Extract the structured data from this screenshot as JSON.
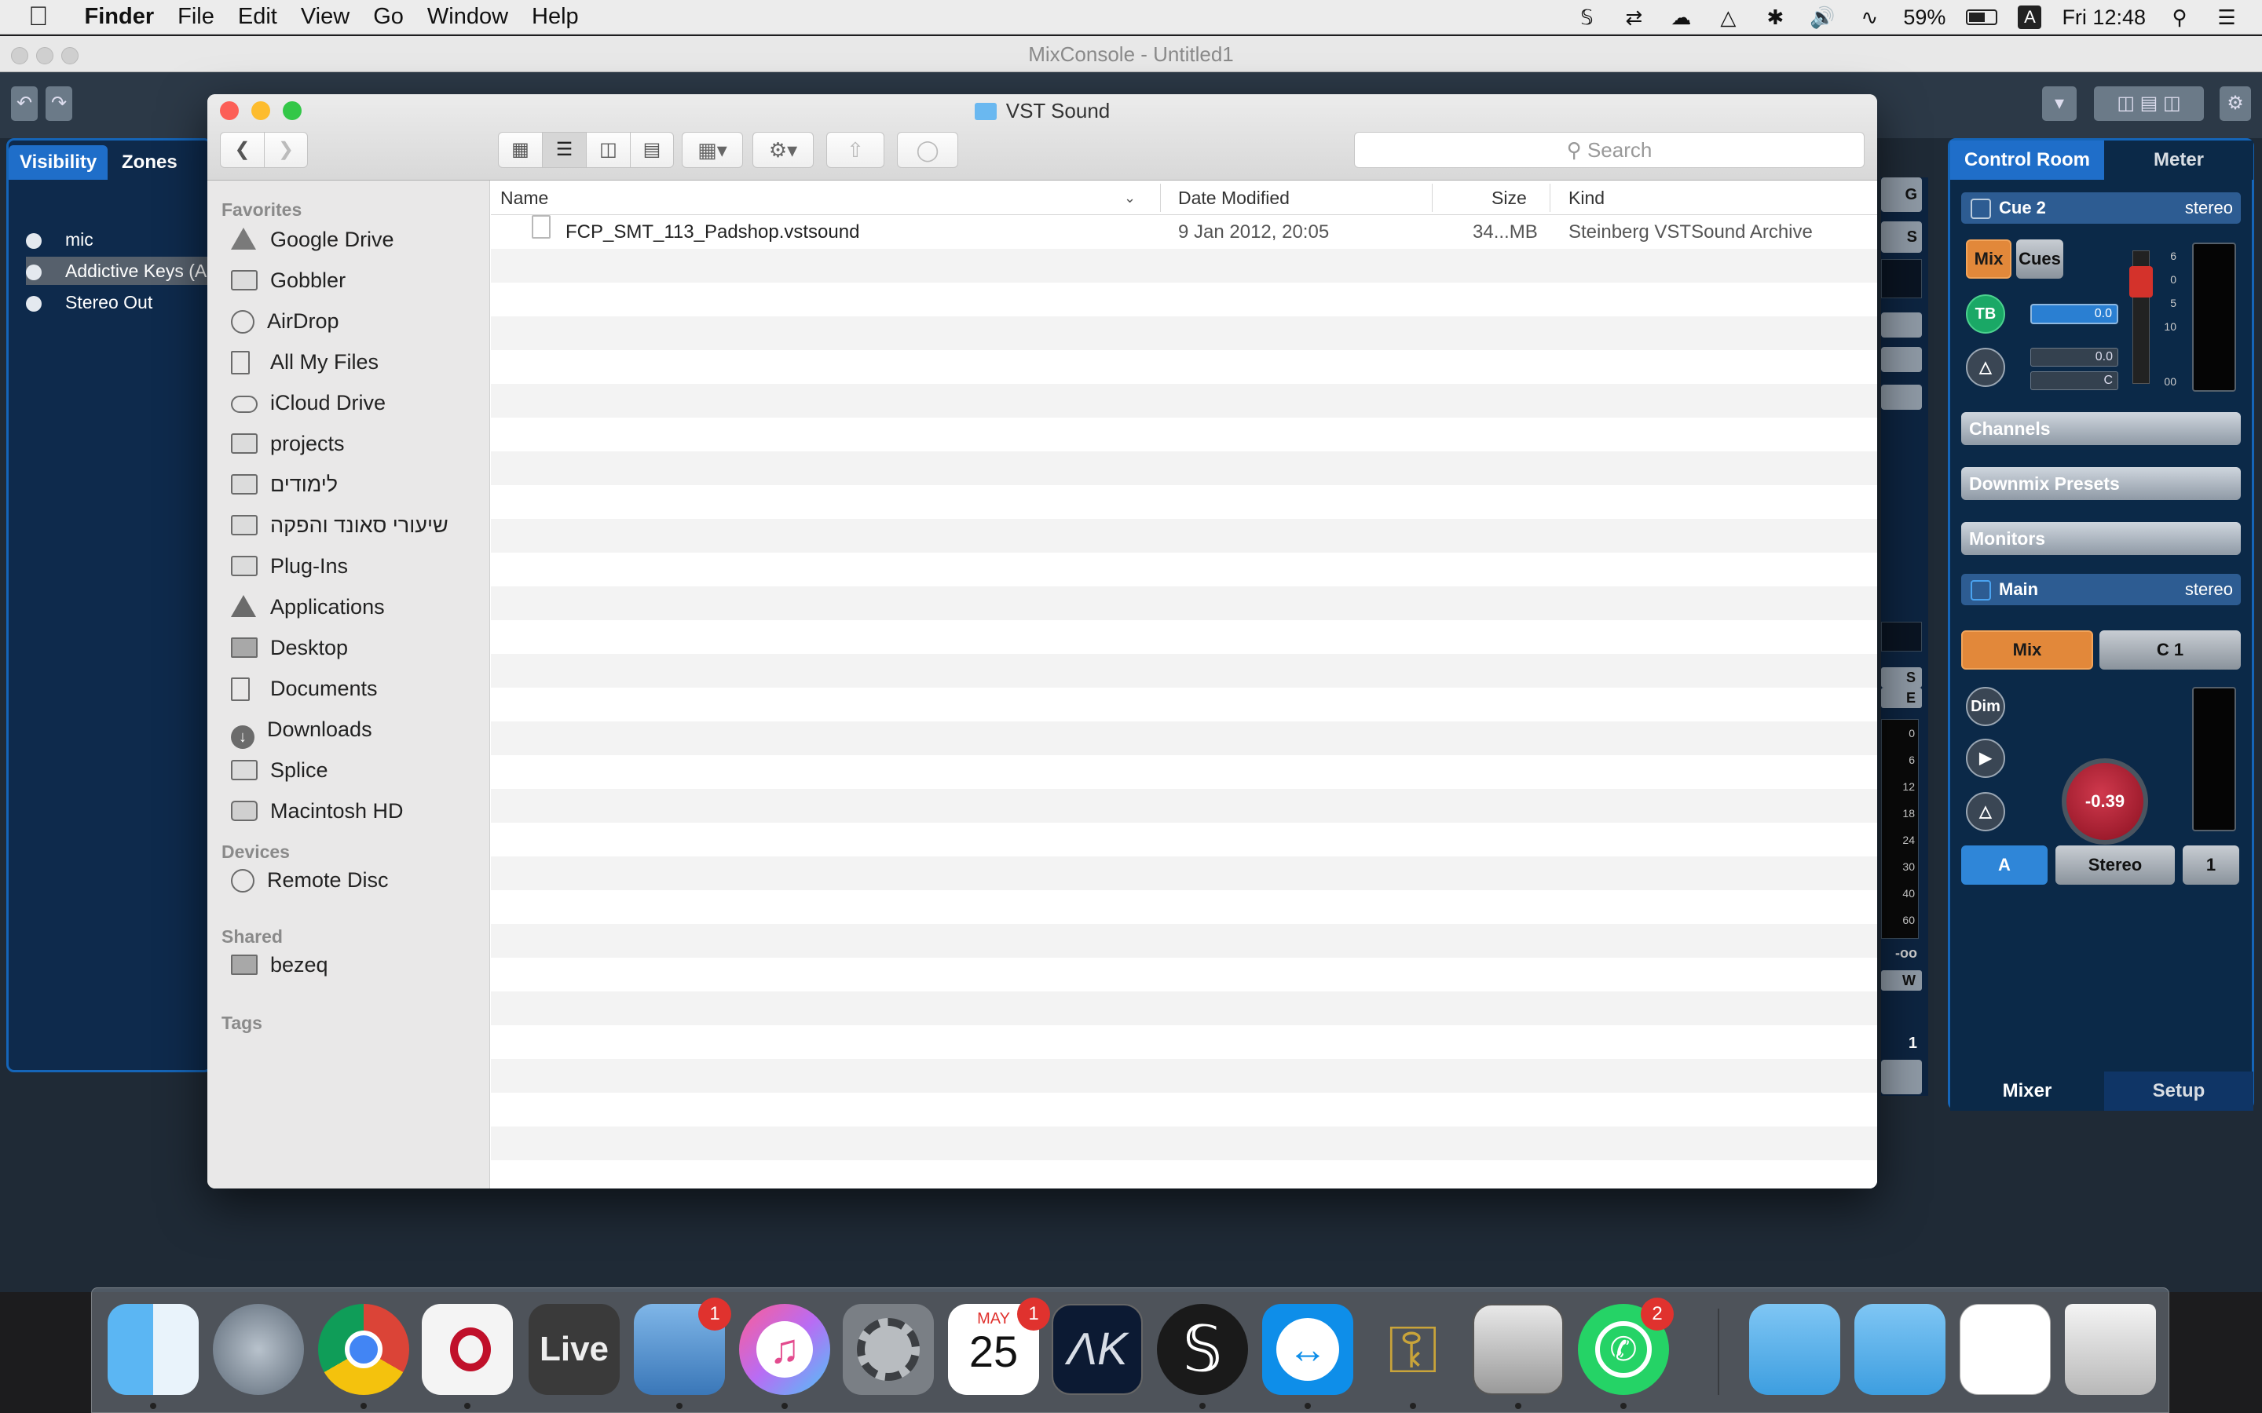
{
  "menubar": {
    "app": "Finder",
    "items": [
      "File",
      "Edit",
      "View",
      "Go",
      "Window",
      "Help"
    ],
    "battery": "59%",
    "input_source": "A",
    "clock": "Fri 12:48"
  },
  "cubase": {
    "window_title": "MixConsole - Untitled1",
    "left_tabs": [
      "Visibility",
      "Zones"
    ],
    "visibility_items": [
      "mic",
      "Addictive Keys (A",
      "Stereo Out"
    ],
    "right_tabs": [
      "Control Room",
      "Meter"
    ],
    "cue_label": "Cue 2",
    "cue_format": "stereo",
    "mix_label": "Mix",
    "cues_label": "Cues",
    "tb_label": "TB",
    "tb_level": "0.0",
    "pan_level": "0.0",
    "pan_pos": "C",
    "fader_scale": [
      "6",
      "0",
      "5",
      "10",
      "00"
    ],
    "sections": [
      "Channels",
      "Downmix Presets",
      "Monitors"
    ],
    "main_label": "Main",
    "main_format": "stereo",
    "main_mix": "Mix",
    "main_c1": "C 1",
    "dim_label": "Dim",
    "knob_value": "-0.39",
    "bottom_buttons": [
      "A",
      "Stereo",
      "1"
    ],
    "bottom_tabs": [
      "Mixer",
      "Setup"
    ],
    "mid_labels": [
      "G",
      "S",
      "S",
      "E",
      "0",
      "6",
      "12",
      "18",
      "24",
      "30",
      "40",
      "60",
      "-oo",
      "W",
      "1"
    ]
  },
  "finder": {
    "title": "VST Sound",
    "search_placeholder": "Search",
    "sidebar": {
      "favorites_header": "Favorites",
      "favorites": [
        "Google Drive",
        "Gobbler",
        "AirDrop",
        "All My Files",
        "iCloud Drive",
        "projects",
        "לימודים",
        "שיעורי סאונד והפקה",
        "Plug-Ins",
        "Applications",
        "Desktop",
        "Documents",
        "Downloads",
        "Splice",
        "Macintosh HD"
      ],
      "devices_header": "Devices",
      "devices": [
        "Remote Disc"
      ],
      "shared_header": "Shared",
      "shared": [
        "bezeq"
      ],
      "tags_header": "Tags"
    },
    "columns": {
      "name": "Name",
      "date": "Date Modified",
      "size": "Size",
      "kind": "Kind"
    },
    "files": [
      {
        "name": "FCP_SMT_113_Padshop.vstsound",
        "date": "9 Jan 2012, 20:05",
        "size": "34...MB",
        "kind": "Steinberg VSTSound Archive"
      }
    ]
  },
  "dock": {
    "apps": [
      "Finder",
      "Launchpad",
      "Google Chrome",
      "Cubase",
      "Ableton Live",
      "Mail",
      "iTunes",
      "System Preferences",
      "Calendar",
      "Addictive Keys",
      "Splice",
      "TeamViewer",
      "Keychain Access",
      "Audiofuse",
      "WhatsApp",
      "Downloads Folder",
      "Documents Folder",
      "Document",
      "Trash"
    ],
    "live_label": "Live",
    "calendar_month": "MAY",
    "calendar_day": "25",
    "mail_badge": "1",
    "calendar_badge": "1",
    "whatsapp_badge": "2"
  },
  "colors": {
    "cubase_accent": "#1565b8",
    "orange": "#e2883a",
    "finder_blue": "#6ab8f0",
    "close": "#fc5f57",
    "minimize": "#fdbc2e",
    "zoom": "#33c748"
  }
}
